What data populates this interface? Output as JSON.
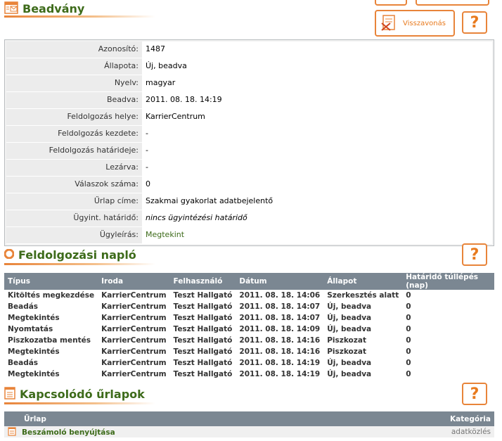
{
  "header": {
    "title": "Beadvány",
    "revoke_label": "Visszavonás",
    "help_label": "?"
  },
  "details": [
    {
      "label": "Azonosító:",
      "value": "1487"
    },
    {
      "label": "Állapota:",
      "value": "Új, beadva"
    },
    {
      "label": "Nyelv:",
      "value": "magyar"
    },
    {
      "label": "Beadva:",
      "value": "2011. 08. 18. 14:19"
    },
    {
      "label": "Feldolgozás helye:",
      "value": "KarrierCentrum"
    },
    {
      "label": "Feldolgozás kezdete:",
      "value": "-"
    },
    {
      "label": "Feldolgozás határideje:",
      "value": "-"
    },
    {
      "label": "Lezárva:",
      "value": "-"
    },
    {
      "label": "Válaszok száma:",
      "value": "0"
    },
    {
      "label": "Űrlap címe:",
      "value": "Szakmai gyakorlat adatbejelentő"
    },
    {
      "label": "Ügyint. határidő:",
      "value": "nincs ügyintézési határidő"
    },
    {
      "label": "Ügyleírás:",
      "value": "Megtekint"
    }
  ],
  "log": {
    "title": "Feldolgozási napló",
    "columns": [
      "Típus",
      "Iroda",
      "Felhasználó",
      "Dátum",
      "Állapot",
      "Határidő túllépés (nap)"
    ],
    "rows": [
      [
        "Kitöltés megkezdése",
        "KarrierCentrum",
        "Teszt Hallgató",
        "2011. 08. 18. 14:06",
        "Szerkesztés alatt",
        "0"
      ],
      [
        "Beadás",
        "KarrierCentrum",
        "Teszt Hallgató",
        "2011. 08. 18. 14:07",
        "Új, beadva",
        "0"
      ],
      [
        "Megtekintés",
        "KarrierCentrum",
        "Teszt Hallgató",
        "2011. 08. 18. 14:07",
        "Új, beadva",
        "0"
      ],
      [
        "Nyomtatás",
        "KarrierCentrum",
        "Teszt Hallgató",
        "2011. 08. 18. 14:09",
        "Új, beadva",
        "0"
      ],
      [
        "Piszkozatba mentés",
        "KarrierCentrum",
        "Teszt Hallgató",
        "2011. 08. 18. 14:16",
        "Piszkozat",
        "0"
      ],
      [
        "Megtekintés",
        "KarrierCentrum",
        "Teszt Hallgató",
        "2011. 08. 18. 14:16",
        "Piszkozat",
        "0"
      ],
      [
        "Beadás",
        "KarrierCentrum",
        "Teszt Hallgató",
        "2011. 08. 18. 14:19",
        "Új, beadva",
        "0"
      ],
      [
        "Megtekintés",
        "KarrierCentrum",
        "Teszt Hallgató",
        "2011. 08. 18. 14:19",
        "Új, beadva",
        "0"
      ]
    ]
  },
  "forms": {
    "title": "Kapcsolódó űrlapok",
    "columns": [
      "Űrlap",
      "Kategória"
    ],
    "rows": [
      {
        "name": "Beszámoló benyújtása",
        "category": "adatközlés"
      }
    ]
  },
  "colors": {
    "accent": "#e8843a",
    "title_green": "#3d6b1a",
    "table_header": "#7b8792"
  },
  "icons": [
    "mail-doc-icon",
    "revoke-icon",
    "log-icon",
    "form-doc-icon"
  ]
}
